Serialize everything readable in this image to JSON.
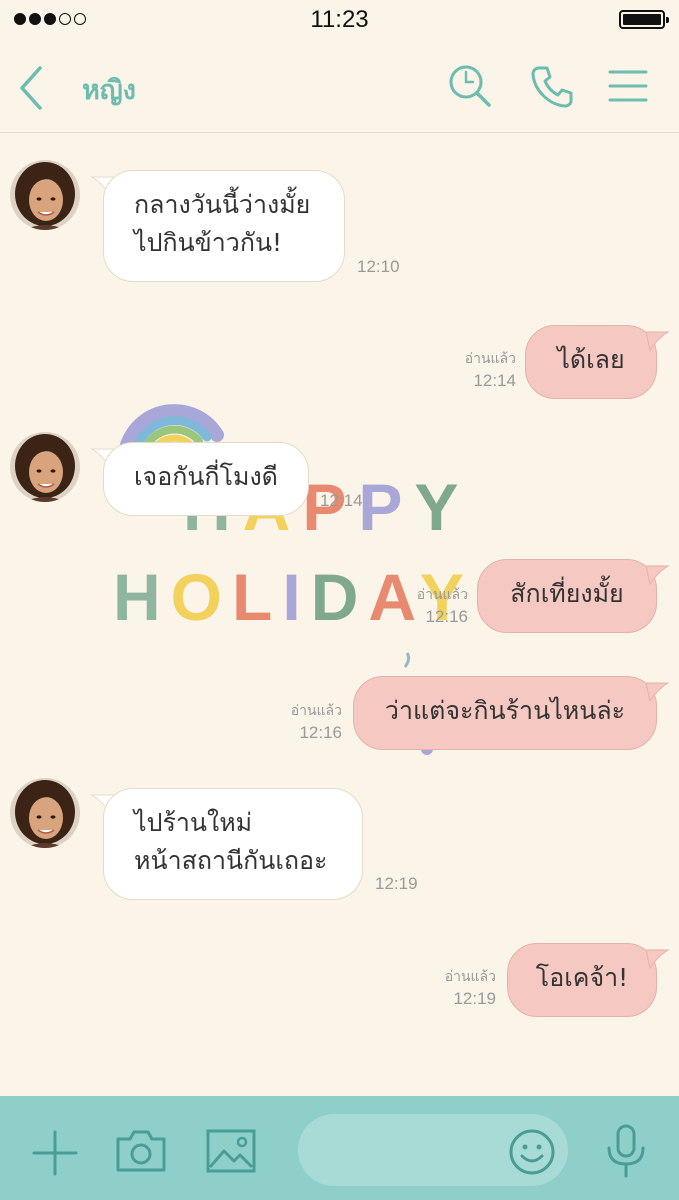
{
  "status_bar": {
    "time": "11:23",
    "signal_filled": 3,
    "signal_total": 5
  },
  "header": {
    "contact_name": "หญิง",
    "accent_color": "#6cbcb0",
    "icons": [
      "back-chevron-icon",
      "search-icon",
      "phone-icon",
      "menu-icon"
    ]
  },
  "sticker": {
    "line1": "HAPPY",
    "line2": "HOLIDAY"
  },
  "messages": [
    {
      "side": "in",
      "lines": [
        "กลางวันนี้ว่างมั้ย",
        "ไปกินข้าวกัน!"
      ],
      "time": "12:10"
    },
    {
      "side": "out",
      "lines": [
        "ได้เลย"
      ],
      "read": "อ่านแล้ว",
      "time": "12:14"
    },
    {
      "side": "in",
      "lines": [
        "เจอกันกี่โมงดี"
      ],
      "time": "12:14"
    },
    {
      "side": "out",
      "lines": [
        "สักเที่ยงมั้ย"
      ],
      "read": "อ่านแล้ว",
      "time": "12:16"
    },
    {
      "side": "out",
      "lines": [
        "ว่าแต่จะกินร้านไหนล่ะ"
      ],
      "read": "อ่านแล้ว",
      "time": "12:16"
    },
    {
      "side": "in",
      "lines": [
        "ไปร้านใหม่",
        "หน้าสถานีกันเถอะ"
      ],
      "time": "12:19"
    },
    {
      "side": "out",
      "lines": [
        "โอเคจ้า!"
      ],
      "read": "อ่านแล้ว",
      "time": "12:19"
    }
  ],
  "bottom_bar": {
    "icons": [
      "plus-icon",
      "camera-icon",
      "image-icon",
      "emoji-icon",
      "microphone-icon"
    ],
    "color": "#8fcfca"
  }
}
